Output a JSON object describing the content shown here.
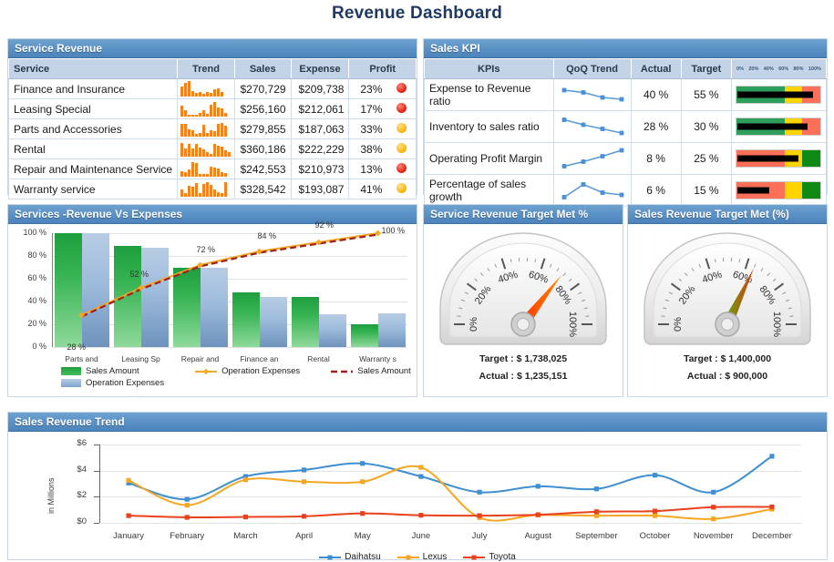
{
  "title": "Revenue Dashboard",
  "accent": "#4c84bb",
  "panels": {
    "service_revenue": {
      "title": "Service Revenue"
    },
    "sales_kpi": {
      "title": "Sales KPI"
    },
    "rev_vs_exp": {
      "title": "Services -Revenue Vs Expenses"
    },
    "service_gauge": {
      "title": "Service Revenue Target Met %"
    },
    "sales_gauge": {
      "title": "Sales Revenue Target Met (%)"
    },
    "sales_trend": {
      "title": "Sales Revenue Trend"
    }
  },
  "service_revenue": {
    "columns": [
      "Service",
      "Trend",
      "Sales",
      "Expense",
      "Profit"
    ],
    "rows": [
      {
        "service": "Finance and Insurance",
        "sales": "$270,729",
        "expense": "$209,738",
        "profit": "23%",
        "status": "red",
        "trend": [
          62,
          88,
          100,
          38,
          22,
          30,
          18,
          30,
          22,
          45,
          55,
          30
        ]
      },
      {
        "service": "Leasing Special",
        "sales": "$256,160",
        "expense": "$212,061",
        "profit": "17%",
        "status": "red",
        "trend": [
          72,
          40,
          12,
          10,
          12,
          22,
          42,
          18,
          78,
          95,
          58,
          50,
          25
        ]
      },
      {
        "service": "Parts and Accessories",
        "sales": "$279,855",
        "expense": "$187,063",
        "profit": "33%",
        "status": "amber",
        "trend": [
          85,
          80,
          45,
          40,
          18,
          22,
          75,
          25,
          42,
          38,
          82,
          88,
          72
        ]
      },
      {
        "service": "Rental",
        "sales": "$360,186",
        "expense": "$222,229",
        "profit": "38%",
        "status": "amber",
        "trend": [
          88,
          55,
          85,
          55,
          80,
          60,
          48,
          28,
          20,
          80,
          70,
          62,
          40,
          28
        ]
      },
      {
        "service": "Repair and Maintenance Service",
        "sales": "$242,553",
        "expense": "$210,973",
        "profit": "13%",
        "status": "red",
        "trend": [
          35,
          30,
          45,
          92,
          88,
          20,
          15,
          18,
          62,
          58,
          52,
          30,
          22
        ]
      },
      {
        "service": "Warranty service",
        "sales": "$328,542",
        "expense": "$193,087",
        "profit": "41%",
        "status": "amber",
        "trend": [
          48,
          25,
          72,
          62,
          88,
          22,
          82,
          95,
          78,
          48,
          30,
          25,
          92
        ]
      }
    ]
  },
  "sales_kpi": {
    "columns": [
      "KPIs",
      "QoQ Trend",
      "Actual",
      "Target"
    ],
    "scale_labels": [
      "0%",
      "20%",
      "40%",
      "60%",
      "80%",
      "100%"
    ],
    "rows": [
      {
        "kpi": "Expense to Revenue ratio",
        "actual": "40 %",
        "target": "55 %",
        "spark": [
          72,
          62,
          40,
          32
        ],
        "bands": [
          {
            "color": "#2e9e5b",
            "to": 58
          },
          {
            "color": "#fdd400",
            "to": 78
          },
          {
            "color": "#fc7059",
            "to": 100
          }
        ],
        "bar_pct": 90
      },
      {
        "kpi": "Inventory to sales ratio",
        "actual": "28 %",
        "target": "30 %",
        "spark": [
          82,
          60,
          42,
          24
        ],
        "bands": [
          {
            "color": "#2e9e5b",
            "to": 58
          },
          {
            "color": "#fdd400",
            "to": 78
          },
          {
            "color": "#fc7059",
            "to": 100
          }
        ],
        "bar_pct": 84
      },
      {
        "kpi": "Operating Profit Margin",
        "actual": "8 %",
        "target": "25 %",
        "spark": [
          18,
          38,
          62,
          88
        ],
        "bands": [
          {
            "color": "#fc7059",
            "to": 58
          },
          {
            "color": "#fdd400",
            "to": 78
          },
          {
            "color": "#0f8a14",
            "to": 100
          }
        ],
        "bar_pct": 73
      },
      {
        "kpi": "Percentage of sales growth",
        "actual": "6 %",
        "target": "15 %",
        "spark": [
          22,
          78,
          42,
          32
        ],
        "bands": [
          {
            "color": "#fc7059",
            "to": 58
          },
          {
            "color": "#fdd400",
            "to": 78
          },
          {
            "color": "#0f8a14",
            "to": 100
          }
        ],
        "bar_pct": 38
      }
    ]
  },
  "chart_data": [
    {
      "type": "bar",
      "id": "revenue_vs_expenses",
      "title": "Services -Revenue Vs Expenses",
      "xlabel": "",
      "ylabel": "",
      "ylim": [
        0,
        100
      ],
      "yticks": [
        "0 %",
        "20 %",
        "40 %",
        "60 %",
        "80 %",
        "100 %"
      ],
      "grid": true,
      "legend_position": "bottom",
      "categories": [
        "Parts and",
        "Leasing Sp",
        "Repair and",
        "Finance an",
        "Rental",
        "Warranty s"
      ],
      "series": [
        {
          "name": "Sales Amount",
          "type": "bar",
          "color": "#35b351",
          "values": [
            100,
            89,
            70,
            48,
            44,
            20
          ]
        },
        {
          "name": "Operation Expenses",
          "type": "bar",
          "color": "#9dbbdc",
          "values": [
            100,
            87,
            70,
            44,
            29,
            30
          ]
        },
        {
          "name": "Operation Expenses",
          "type": "line",
          "color": "#f5a623",
          "values": [
            28,
            52,
            72,
            84,
            92,
            100
          ]
        },
        {
          "name": "Sales Amount",
          "type": "line-dashed",
          "color": "#a02020",
          "values": [
            28,
            52,
            72,
            84,
            92,
            100
          ]
        }
      ],
      "point_labels": [
        "28 %",
        "52 %",
        "72 %",
        "84 %",
        "92 %",
        "100 %"
      ]
    },
    {
      "type": "line",
      "id": "sales_revenue_trend",
      "title": "Sales Revenue Trend",
      "xlabel": "",
      "ylabel": "in Millions",
      "ylim": [
        0,
        6
      ],
      "yticks": [
        "$0",
        "$2",
        "$4",
        "$6"
      ],
      "grid": true,
      "legend_position": "bottom",
      "categories": [
        "January",
        "February",
        "March",
        "April",
        "May",
        "June",
        "July",
        "August",
        "September",
        "October",
        "November",
        "December"
      ],
      "series": [
        {
          "name": "Daihatsu",
          "color": "#3f8fd2",
          "values": [
            3.05,
            1.8,
            3.55,
            4.05,
            4.55,
            3.55,
            2.35,
            2.8,
            2.6,
            3.65,
            2.35,
            5.1
          ]
        },
        {
          "name": "Lexus",
          "color": "#f5a623",
          "values": [
            3.25,
            1.35,
            3.3,
            3.15,
            3.15,
            4.25,
            0.4,
            0.6,
            0.55,
            0.55,
            0.3,
            1.05
          ]
        },
        {
          "name": "Toyota",
          "color": "#e8411c",
          "values": [
            0.55,
            0.42,
            0.45,
            0.5,
            0.72,
            0.58,
            0.55,
            0.62,
            0.85,
            0.9,
            1.2,
            1.22
          ]
        }
      ]
    }
  ],
  "gauges": [
    {
      "id": "service_revenue_gauge",
      "title": "Service Revenue Target Met %",
      "value_pct": 71,
      "needle_color": "#ff4d00",
      "tick_labels": [
        "0%",
        "20%",
        "40%",
        "60%",
        "80%",
        "100%"
      ],
      "target_label": "Target :",
      "target_value": "$ 1,738,025",
      "actual_label": "Actual :",
      "actual_value": "$ 1,235,151"
    },
    {
      "id": "sales_revenue_gauge",
      "title": "Sales Revenue Target Met (%)",
      "value_pct": 64,
      "needle_color": "#59a618",
      "tick_labels": [
        "0%",
        "20%",
        "40%",
        "60%",
        "80%",
        "100%"
      ],
      "target_label": "Target :",
      "target_value": "$ 1,400,000",
      "actual_label": "Actual :",
      "actual_value": "$ 900,000"
    }
  ],
  "rev_exp_legend": [
    {
      "label": "Sales Amount",
      "kind": "swatch-green"
    },
    {
      "label": "Operation Expenses",
      "kind": "swatch-blue"
    },
    {
      "label": "Operation Expenses",
      "kind": "line-orange"
    },
    {
      "label": "Sales Amount",
      "kind": "line-dashed-red"
    }
  ]
}
